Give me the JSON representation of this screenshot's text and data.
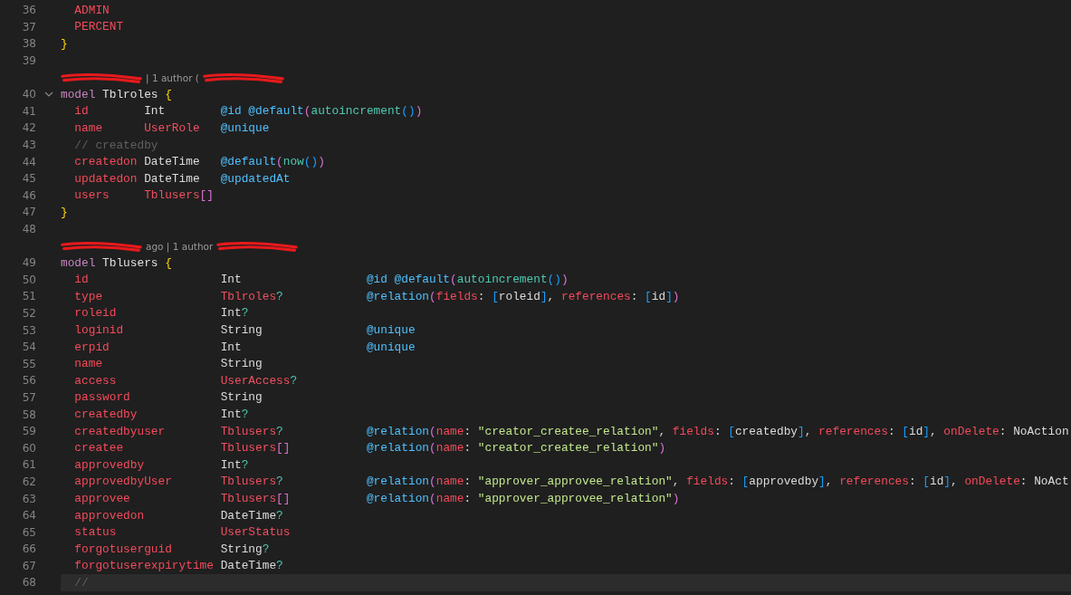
{
  "editor": {
    "lines": [
      {
        "kind": "code",
        "num": "36",
        "indent": true,
        "tokens": [
          {
            "kind": "field",
            "text": "ADMIN"
          }
        ]
      },
      {
        "kind": "code",
        "num": "37",
        "indent": true,
        "tokens": [
          {
            "kind": "field",
            "text": "PERCENT"
          }
        ]
      },
      {
        "kind": "code",
        "num": "38",
        "tokens": [
          {
            "kind": "brace",
            "text": "}"
          }
        ]
      },
      {
        "kind": "empty",
        "num": "39"
      },
      {
        "kind": "blame",
        "parts": [
          {
            "kind": "redacted"
          },
          {
            "kind": "text",
            "text": "| 1 author ("
          },
          {
            "kind": "redacted"
          }
        ]
      },
      {
        "kind": "code",
        "num": "40",
        "fold_icon": true,
        "tokens": [
          {
            "kind": "keyword",
            "text": "model"
          },
          {
            "kind": "name",
            "text": "Tblroles"
          },
          {
            "kind": "brace",
            "text": "{"
          }
        ]
      },
      {
        "kind": "field",
        "num": "41",
        "cells": [
          [
            {
              "kind": "field",
              "text": "id"
            }
          ],
          [
            {
              "kind": "type",
              "text": "Int"
            }
          ],
          [
            {
              "kind": "attr",
              "text": "@id"
            },
            {
              "kind": "attr",
              "text": "@default"
            },
            {
              "kind": "paren",
              "text": "("
            },
            {
              "kind": "func",
              "text": "autoincrement"
            },
            {
              "kind": "bracket",
              "text": "()"
            },
            {
              "kind": "paren",
              "text": ")"
            }
          ]
        ]
      },
      {
        "kind": "field",
        "num": "42",
        "cells": [
          [
            {
              "kind": "field",
              "text": "name"
            }
          ],
          [
            {
              "kind": "custom",
              "text": "UserRole"
            }
          ],
          [
            {
              "kind": "attr",
              "text": "@unique"
            }
          ]
        ]
      },
      {
        "kind": "code",
        "num": "43",
        "indent": true,
        "tokens": [
          {
            "kind": "comment",
            "text": "// createdby"
          }
        ]
      },
      {
        "kind": "field",
        "num": "44",
        "cells": [
          [
            {
              "kind": "field",
              "text": "createdon"
            }
          ],
          [
            {
              "kind": "type",
              "text": "DateTime"
            }
          ],
          [
            {
              "kind": "attr",
              "text": "@default"
            },
            {
              "kind": "paren",
              "text": "("
            },
            {
              "kind": "func",
              "text": "now"
            },
            {
              "kind": "bracket",
              "text": "()"
            },
            {
              "kind": "paren",
              "text": ")"
            }
          ]
        ]
      },
      {
        "kind": "field",
        "num": "45",
        "cells": [
          [
            {
              "kind": "field",
              "text": "updatedon"
            }
          ],
          [
            {
              "kind": "type",
              "text": "DateTime"
            }
          ],
          [
            {
              "kind": "attr",
              "text": "@updatedAt"
            }
          ]
        ]
      },
      {
        "kind": "field",
        "num": "46",
        "cells": [
          [
            {
              "kind": "field",
              "text": "users"
            }
          ],
          [
            {
              "kind": "custom",
              "text": "Tblusers"
            },
            {
              "kind": "paren",
              "text": "[]"
            }
          ]
        ]
      },
      {
        "kind": "code",
        "num": "47",
        "tokens": [
          {
            "kind": "brace",
            "text": "}"
          }
        ]
      },
      {
        "kind": "empty",
        "num": "48"
      },
      {
        "kind": "blame",
        "parts": [
          {
            "kind": "redacted"
          },
          {
            "kind": "text",
            "text": "ago | 1 author"
          },
          {
            "kind": "redacted"
          }
        ]
      },
      {
        "kind": "code",
        "num": "49",
        "tokens": [
          {
            "kind": "keyword",
            "text": "model"
          },
          {
            "kind": "name",
            "text": "Tblusers"
          },
          {
            "kind": "brace",
            "text": "{"
          }
        ]
      },
      {
        "kind": "field",
        "num": "50",
        "cells": [
          [
            {
              "kind": "field",
              "text": "id"
            }
          ],
          [
            {
              "kind": "type",
              "text": "Int"
            }
          ],
          [
            {
              "kind": "attr",
              "text": "@id"
            },
            {
              "kind": "attr",
              "text": "@default"
            },
            {
              "kind": "paren",
              "text": "("
            },
            {
              "kind": "func",
              "text": "autoincrement"
            },
            {
              "kind": "bracket",
              "text": "()"
            },
            {
              "kind": "paren",
              "text": ")"
            }
          ]
        ]
      },
      {
        "kind": "field",
        "num": "51",
        "cells": [
          [
            {
              "kind": "field",
              "text": "type"
            }
          ],
          [
            {
              "kind": "custom",
              "text": "Tblroles"
            },
            {
              "kind": "optional",
              "text": "?"
            }
          ],
          [
            {
              "kind": "attr",
              "text": "@relation"
            },
            {
              "kind": "paren",
              "text": "("
            },
            {
              "kind": "arg",
              "text": "fields"
            },
            {
              "kind": "punct",
              "text": ": "
            },
            {
              "kind": "bracket",
              "text": "["
            },
            {
              "kind": "value",
              "text": "roleid"
            },
            {
              "kind": "bracket",
              "text": "]"
            },
            {
              "kind": "punct",
              "text": ", "
            },
            {
              "kind": "arg",
              "text": "references"
            },
            {
              "kind": "punct",
              "text": ": "
            },
            {
              "kind": "bracket",
              "text": "["
            },
            {
              "kind": "value",
              "text": "id"
            },
            {
              "kind": "bracket",
              "text": "]"
            },
            {
              "kind": "paren",
              "text": ")"
            }
          ]
        ]
      },
      {
        "kind": "field",
        "num": "52",
        "cells": [
          [
            {
              "kind": "field",
              "text": "roleid"
            }
          ],
          [
            {
              "kind": "type",
              "text": "Int"
            },
            {
              "kind": "optional",
              "text": "?"
            }
          ]
        ]
      },
      {
        "kind": "field",
        "num": "53",
        "cells": [
          [
            {
              "kind": "field",
              "text": "loginid"
            }
          ],
          [
            {
              "kind": "type",
              "text": "String"
            }
          ],
          [
            {
              "kind": "attr",
              "text": "@unique"
            }
          ]
        ]
      },
      {
        "kind": "field",
        "num": "54",
        "cells": [
          [
            {
              "kind": "field",
              "text": "erpid"
            }
          ],
          [
            {
              "kind": "type",
              "text": "Int"
            }
          ],
          [
            {
              "kind": "attr",
              "text": "@unique"
            }
          ]
        ]
      },
      {
        "kind": "field",
        "num": "55",
        "cells": [
          [
            {
              "kind": "field",
              "text": "name"
            }
          ],
          [
            {
              "kind": "type",
              "text": "String"
            }
          ]
        ]
      },
      {
        "kind": "field",
        "num": "56",
        "cells": [
          [
            {
              "kind": "field",
              "text": "access"
            }
          ],
          [
            {
              "kind": "custom",
              "text": "UserAccess"
            },
            {
              "kind": "optional",
              "text": "?"
            }
          ]
        ]
      },
      {
        "kind": "field",
        "num": "57",
        "cells": [
          [
            {
              "kind": "field",
              "text": "password"
            }
          ],
          [
            {
              "kind": "type",
              "text": "String"
            }
          ]
        ]
      },
      {
        "kind": "field",
        "num": "58",
        "cells": [
          [
            {
              "kind": "field",
              "text": "createdby"
            }
          ],
          [
            {
              "kind": "type",
              "text": "Int"
            },
            {
              "kind": "optional",
              "text": "?"
            }
          ]
        ]
      },
      {
        "kind": "field",
        "num": "59",
        "cells": [
          [
            {
              "kind": "field",
              "text": "createdbyuser"
            }
          ],
          [
            {
              "kind": "custom",
              "text": "Tblusers"
            },
            {
              "kind": "optional",
              "text": "?"
            }
          ],
          [
            {
              "kind": "attr",
              "text": "@relation"
            },
            {
              "kind": "paren",
              "text": "("
            },
            {
              "kind": "arg",
              "text": "name"
            },
            {
              "kind": "punct",
              "text": ": "
            },
            {
              "kind": "string",
              "text": "\"creator_createe_relation\""
            },
            {
              "kind": "punct",
              "text": ", "
            },
            {
              "kind": "arg",
              "text": "fields"
            },
            {
              "kind": "punct",
              "text": ": "
            },
            {
              "kind": "bracket",
              "text": "["
            },
            {
              "kind": "value",
              "text": "createdby"
            },
            {
              "kind": "bracket",
              "text": "]"
            },
            {
              "kind": "punct",
              "text": ", "
            },
            {
              "kind": "arg",
              "text": "references"
            },
            {
              "kind": "punct",
              "text": ": "
            },
            {
              "kind": "bracket",
              "text": "["
            },
            {
              "kind": "value",
              "text": "id"
            },
            {
              "kind": "bracket",
              "text": "]"
            },
            {
              "kind": "punct",
              "text": ", "
            },
            {
              "kind": "arg",
              "text": "onDelete"
            },
            {
              "kind": "punct",
              "text": ": "
            },
            {
              "kind": "value",
              "text": "NoAction"
            }
          ]
        ]
      },
      {
        "kind": "field",
        "num": "60",
        "cells": [
          [
            {
              "kind": "field",
              "text": "createe"
            }
          ],
          [
            {
              "kind": "custom",
              "text": "Tblusers"
            },
            {
              "kind": "paren",
              "text": "[]"
            }
          ],
          [
            {
              "kind": "attr",
              "text": "@relation"
            },
            {
              "kind": "paren",
              "text": "("
            },
            {
              "kind": "arg",
              "text": "name"
            },
            {
              "kind": "punct",
              "text": ": "
            },
            {
              "kind": "string",
              "text": "\"creator_createe_relation\""
            },
            {
              "kind": "paren",
              "text": ")"
            }
          ]
        ]
      },
      {
        "kind": "field",
        "num": "61",
        "cells": [
          [
            {
              "kind": "field",
              "text": "approvedby"
            }
          ],
          [
            {
              "kind": "type",
              "text": "Int"
            },
            {
              "kind": "optional",
              "text": "?"
            }
          ]
        ]
      },
      {
        "kind": "field",
        "num": "62",
        "cells": [
          [
            {
              "kind": "field",
              "text": "approvedbyUser"
            }
          ],
          [
            {
              "kind": "custom",
              "text": "Tblusers"
            },
            {
              "kind": "optional",
              "text": "?"
            }
          ],
          [
            {
              "kind": "attr",
              "text": "@relation"
            },
            {
              "kind": "paren",
              "text": "("
            },
            {
              "kind": "arg",
              "text": "name"
            },
            {
              "kind": "punct",
              "text": ": "
            },
            {
              "kind": "string",
              "text": "\"approver_approvee_relation\""
            },
            {
              "kind": "punct",
              "text": ", "
            },
            {
              "kind": "arg",
              "text": "fields"
            },
            {
              "kind": "punct",
              "text": ": "
            },
            {
              "kind": "bracket",
              "text": "["
            },
            {
              "kind": "value",
              "text": "approvedby"
            },
            {
              "kind": "bracket",
              "text": "]"
            },
            {
              "kind": "punct",
              "text": ", "
            },
            {
              "kind": "arg",
              "text": "references"
            },
            {
              "kind": "punct",
              "text": ": "
            },
            {
              "kind": "bracket",
              "text": "["
            },
            {
              "kind": "value",
              "text": "id"
            },
            {
              "kind": "bracket",
              "text": "]"
            },
            {
              "kind": "punct",
              "text": ", "
            },
            {
              "kind": "arg",
              "text": "onDelete"
            },
            {
              "kind": "punct",
              "text": ": "
            },
            {
              "kind": "value",
              "text": "NoAct"
            }
          ]
        ]
      },
      {
        "kind": "field",
        "num": "63",
        "cells": [
          [
            {
              "kind": "field",
              "text": "approvee"
            }
          ],
          [
            {
              "kind": "custom",
              "text": "Tblusers"
            },
            {
              "kind": "paren",
              "text": "[]"
            }
          ],
          [
            {
              "kind": "attr",
              "text": "@relation"
            },
            {
              "kind": "paren",
              "text": "("
            },
            {
              "kind": "arg",
              "text": "name"
            },
            {
              "kind": "punct",
              "text": ": "
            },
            {
              "kind": "string",
              "text": "\"approver_approvee_relation\""
            },
            {
              "kind": "paren",
              "text": ")"
            }
          ]
        ]
      },
      {
        "kind": "field",
        "num": "64",
        "cells": [
          [
            {
              "kind": "field",
              "text": "approvedon"
            }
          ],
          [
            {
              "kind": "type",
              "text": "DateTime"
            },
            {
              "kind": "optional",
              "text": "?"
            }
          ]
        ]
      },
      {
        "kind": "field",
        "num": "65",
        "cells": [
          [
            {
              "kind": "field",
              "text": "status"
            }
          ],
          [
            {
              "kind": "custom",
              "text": "UserStatus"
            }
          ]
        ]
      },
      {
        "kind": "field",
        "num": "66",
        "cells": [
          [
            {
              "kind": "field",
              "text": "forgotuserguid"
            }
          ],
          [
            {
              "kind": "type",
              "text": "String"
            },
            {
              "kind": "optional",
              "text": "?"
            }
          ]
        ]
      },
      {
        "kind": "field",
        "num": "67",
        "cells": [
          [
            {
              "kind": "field",
              "text": "forgotuserexpirytime"
            }
          ],
          [
            {
              "kind": "type",
              "text": "DateTime"
            },
            {
              "kind": "optional",
              "text": "?"
            }
          ]
        ]
      },
      {
        "kind": "code",
        "num": "68",
        "indent": true,
        "current": true,
        "tokens": [
          {
            "kind": "comment",
            "text": "//"
          }
        ]
      }
    ]
  }
}
